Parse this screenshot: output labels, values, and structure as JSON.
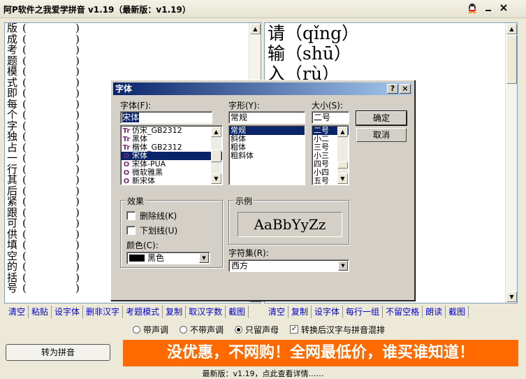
{
  "window": {
    "title": "阿P软件之我爱学拼音 v1.19（最新版：v1.19）",
    "icons": [
      "qq-icon",
      "minimize-icon",
      "close-icon"
    ]
  },
  "left_pane": {
    "rows": [
      {
        "char": "版",
        "p1": "(",
        "p2": ")"
      },
      {
        "char": "成",
        "p1": "(",
        "p2": ")"
      },
      {
        "char": "考",
        "p1": "(",
        "p2": ")"
      },
      {
        "char": "题",
        "p1": "(",
        "p2": ")"
      },
      {
        "char": "模",
        "p1": "(",
        "p2": ")"
      },
      {
        "char": "式",
        "p1": "(",
        "p2": ")"
      },
      {
        "char": "即",
        "p1": "(",
        "p2": ")"
      },
      {
        "char": "每",
        "p1": "(",
        "p2": ")"
      },
      {
        "char": "个",
        "p1": "(",
        "p2": ")"
      },
      {
        "char": "字",
        "p1": "(",
        "p2": ")"
      },
      {
        "char": "独",
        "p1": "(",
        "p2": ")"
      },
      {
        "char": "占",
        "p1": "(",
        "p2": ")"
      },
      {
        "char": "一",
        "p1": "(",
        "p2": ")"
      },
      {
        "char": "行",
        "p1": "(",
        "p2": ")"
      },
      {
        "char": "其",
        "p1": "(",
        "p2": ")"
      },
      {
        "char": "后",
        "p1": "(",
        "p2": ")"
      },
      {
        "char": "紧",
        "p1": "(",
        "p2": ")"
      },
      {
        "char": "跟",
        "p1": "(",
        "p2": ")"
      },
      {
        "char": "可",
        "p1": "(",
        "p2": ")"
      },
      {
        "char": "供",
        "p1": "(",
        "p2": ")"
      },
      {
        "char": "填",
        "p1": "(",
        "p2": ")"
      },
      {
        "char": "空",
        "p1": "(",
        "p2": ")"
      },
      {
        "char": "的",
        "p1": "(",
        "p2": ")"
      },
      {
        "char": "括",
        "p1": "(",
        "p2": ")"
      },
      {
        "char": "号",
        "p1": "(",
        "p2": ")"
      }
    ]
  },
  "right_pane": {
    "rows": [
      "请（qǐng）",
      "输（shū）",
      "入（rù）"
    ]
  },
  "left_links": [
    "清空",
    "粘贴",
    "设字体",
    "删非汉字",
    "考题模式",
    "复制",
    "取汉字数",
    "截图"
  ],
  "right_links": [
    "清空",
    "复制",
    "设字体",
    "每行一组",
    "不留空格",
    "朗读",
    "截图"
  ],
  "options": {
    "radio_1": "带声调",
    "radio_2": "不带声调",
    "radio_3": "只留声母",
    "radio_selected": 3,
    "checkbox": "转换后汉字与拼音混排",
    "checkbox_checked": true
  },
  "convert_button": "转为拼音",
  "banner": "没优惠，不网购！全网最低价，谁买谁知道！",
  "status": "最新版：v1.19，点此查看详情……",
  "font_dialog": {
    "title": "字体",
    "help": "?",
    "close": "×",
    "font_label": "字体(F):",
    "font_value": "宋体",
    "fonts": [
      {
        "icon": "Tr",
        "name": "仿宋_GB2312",
        "selected": false
      },
      {
        "icon": "Tr",
        "name": "黑体",
        "selected": false
      },
      {
        "icon": "Tr",
        "name": "楷体_GB2312",
        "selected": false
      },
      {
        "icon": "O",
        "name": "宋体",
        "selected": true
      },
      {
        "icon": "O",
        "name": "宋体-PUA",
        "selected": false
      },
      {
        "icon": "O",
        "name": "微软雅黑",
        "selected": false
      },
      {
        "icon": "O",
        "name": "新宋体",
        "selected": false
      }
    ],
    "style_label": "字形(Y):",
    "style_value": "常规",
    "styles": [
      {
        "name": "常规",
        "selected": true
      },
      {
        "name": "斜体",
        "selected": false
      },
      {
        "name": "粗体",
        "selected": false
      },
      {
        "name": "粗斜体",
        "selected": false
      }
    ],
    "size_label": "大小(S):",
    "size_value": "二号",
    "sizes": [
      {
        "name": "二号",
        "selected": true
      },
      {
        "name": "小二",
        "selected": false
      },
      {
        "name": "三号",
        "selected": false
      },
      {
        "name": "小三",
        "selected": false
      },
      {
        "name": "四号",
        "selected": false
      },
      {
        "name": "小四",
        "selected": false
      },
      {
        "name": "五号",
        "selected": false
      }
    ],
    "ok": "确定",
    "cancel": "取消",
    "effects_label": "效果",
    "strike_label": "删除线(K)",
    "underline_label": "下划线(U)",
    "color_label": "颜色(C):",
    "color_value": "黑色",
    "color_hex": "#000000",
    "sample_label": "示例",
    "sample_text": "AaBbYyZz",
    "charset_label": "字符集(R):",
    "charset_value": "西方"
  },
  "colors": {
    "banner": "#ff6a00",
    "link": "#0000cc",
    "dialog_title_start": "#0a246a",
    "dialog_title_end": "#a6caf0"
  }
}
